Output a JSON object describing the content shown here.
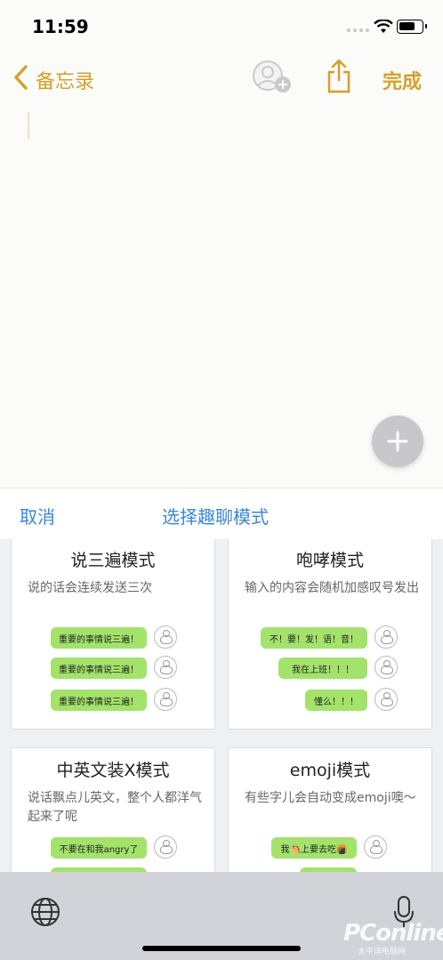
{
  "status_bar": {
    "time": "11:59"
  },
  "nav": {
    "back_label": "备忘录",
    "done_label": "完成"
  },
  "sheet": {
    "cancel_label": "取消",
    "title": "选择趣聊模式"
  },
  "cards": [
    {
      "title": "说三遍模式",
      "description": "说的话会连续发送三次",
      "bubbles": [
        "重要的事情说三遍！",
        "重要的事情说三遍！",
        "重要的事情说三遍！"
      ]
    },
    {
      "title": "咆哮模式",
      "description": "输入的内容会随机加感叹号发出",
      "bubbles": [
        "不！要！发！语！音！",
        "我在上班！！！",
        "懂么！！！"
      ]
    },
    {
      "title": "中英文装X模式",
      "description": "说话飘点儿英文，整个人都洋气起来了呢",
      "bubbles": [
        "不要在和我angry了"
      ]
    },
    {
      "title": "emoji模式",
      "description": "有些字儿会自动变成emoji噢～",
      "bubbles": [
        "我🐴上要去吃🍘"
      ]
    }
  ],
  "watermark": {
    "brand": "PConline",
    "sub": "太平洋电脑网"
  },
  "icons": [
    "chevron-left-icon",
    "add-person-icon",
    "share-icon",
    "plus-icon",
    "globe-icon",
    "microphone-icon",
    "wifi-icon",
    "battery-icon"
  ],
  "colors": {
    "accent_gold": "#d4a12a",
    "sheet_blue": "#3b87d8",
    "bubble_green": "#a3e36b"
  }
}
